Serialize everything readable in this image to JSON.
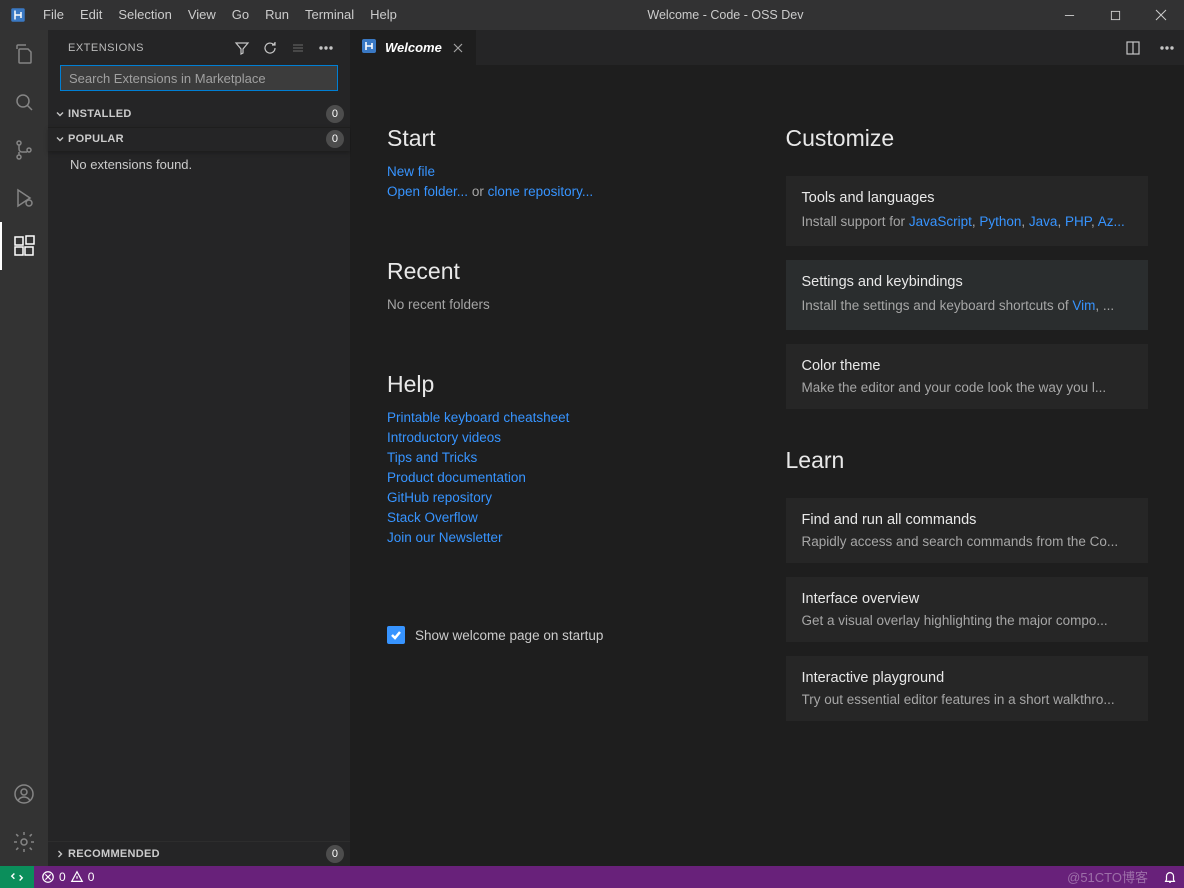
{
  "window": {
    "title": "Welcome - Code - OSS Dev"
  },
  "menu": [
    "File",
    "Edit",
    "Selection",
    "View",
    "Go",
    "Run",
    "Terminal",
    "Help"
  ],
  "sidebar": {
    "title": "EXTENSIONS",
    "search_placeholder": "Search Extensions in Marketplace",
    "sections": {
      "installed": {
        "label": "INSTALLED",
        "count": "0"
      },
      "popular": {
        "label": "POPULAR",
        "count": "0",
        "body": "No extensions found."
      },
      "recommended": {
        "label": "RECOMMENDED",
        "count": "0"
      }
    }
  },
  "tab": {
    "label": "Welcome"
  },
  "welcome": {
    "start": {
      "heading": "Start",
      "new_file": "New file",
      "open_folder": "Open folder...",
      "or": " or ",
      "clone": "clone repository..."
    },
    "recent": {
      "heading": "Recent",
      "empty": "No recent folders"
    },
    "help": {
      "heading": "Help",
      "links": [
        "Printable keyboard cheatsheet",
        "Introductory videos",
        "Tips and Tricks",
        "Product documentation",
        "GitHub repository",
        "Stack Overflow",
        "Join our Newsletter"
      ]
    },
    "show_on_startup": "Show welcome page on startup",
    "customize": {
      "heading": "Customize",
      "tools": {
        "title": "Tools and languages",
        "prefix": "Install support for ",
        "links": [
          "JavaScript",
          "Python",
          "Java",
          "PHP",
          "Az..."
        ],
        "sep": ", "
      },
      "settings": {
        "title": "Settings and keybindings",
        "prefix": "Install the settings and keyboard shortcuts of ",
        "link": "Vim",
        "suffix": ", ..."
      },
      "theme": {
        "title": "Color theme",
        "desc": "Make the editor and your code look the way you l..."
      }
    },
    "learn": {
      "heading": "Learn",
      "commands": {
        "title": "Find and run all commands",
        "desc": "Rapidly access and search commands from the Co..."
      },
      "overview": {
        "title": "Interface overview",
        "desc": "Get a visual overlay highlighting the major compo..."
      },
      "playground": {
        "title": "Interactive playground",
        "desc": "Try out essential editor features in a short walkthro..."
      }
    }
  },
  "status": {
    "errors": "0",
    "warnings": "0"
  },
  "watermark": "@51CTO博客"
}
